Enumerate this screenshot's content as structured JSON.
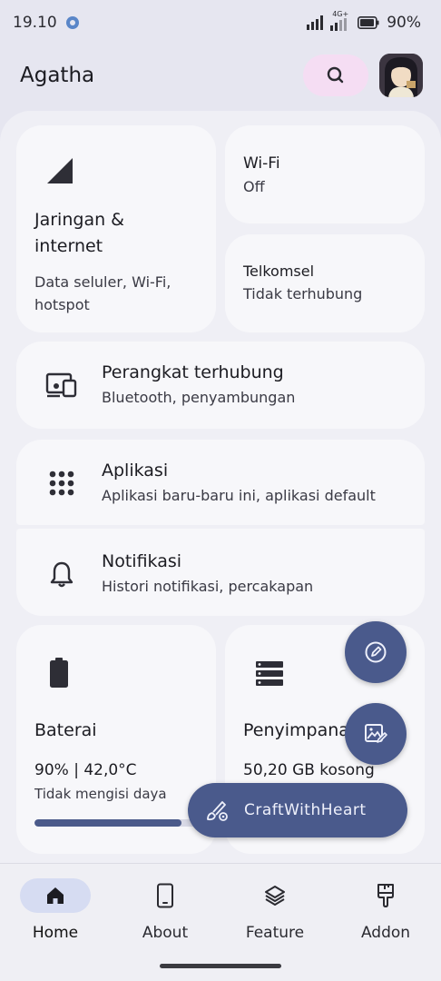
{
  "status_bar": {
    "time": "19.10",
    "network_type": "4G+",
    "battery_percent": "90%"
  },
  "header": {
    "title": "Agatha",
    "search_icon": "search-icon",
    "avatar_icon": "avatar"
  },
  "cards": {
    "network": {
      "title_line1": "Jaringan &",
      "title_line2": "internet",
      "subtitle_line1": "Data seluler, Wi-Fi,",
      "subtitle_line2": "hotspot",
      "icon": "signal-icon"
    },
    "wifi": {
      "title": "Wi-Fi",
      "status": "Off"
    },
    "sim": {
      "title": "Telkomsel",
      "status": "Tidak terhubung"
    },
    "connected_devices": {
      "title": "Perangkat terhubung",
      "subtitle": "Bluetooth, penyambungan",
      "icon": "devices-icon"
    },
    "apps": {
      "title": "Aplikasi",
      "subtitle": "Aplikasi baru-baru ini, aplikasi default",
      "icon": "apps-grid-icon"
    },
    "notifications": {
      "title": "Notifikasi",
      "subtitle": "Histori notifikasi, percakapan",
      "icon": "bell-icon"
    },
    "battery": {
      "title": "Baterai",
      "value": "90% | 42,0°C",
      "status": "Tidak mengisi daya",
      "level": 0.9,
      "icon": "battery-icon"
    },
    "storage": {
      "title": "Penyimpana",
      "value": "50,20 GB kosong",
      "icon": "storage-icon"
    }
  },
  "fabs": {
    "edit_icon": "edit-icon",
    "wallpaper_icon": "wallpaper-edit-icon",
    "extended_label": "CraftWithHeart",
    "extended_icon": "brush-gear-icon"
  },
  "bottom_nav": {
    "items": [
      {
        "label": "Home",
        "icon": "home-icon",
        "active": true
      },
      {
        "label": "About",
        "icon": "phone-icon",
        "active": false
      },
      {
        "label": "Feature",
        "icon": "layers-icon",
        "active": false
      },
      {
        "label": "Addon",
        "icon": "brush-icon",
        "active": false
      }
    ]
  },
  "colors": {
    "accent": "#4a5a8c",
    "search_bg": "#f5ddf3",
    "nav_active_bg": "#d6dcf2",
    "progress_fill": "#4b5a8a"
  }
}
